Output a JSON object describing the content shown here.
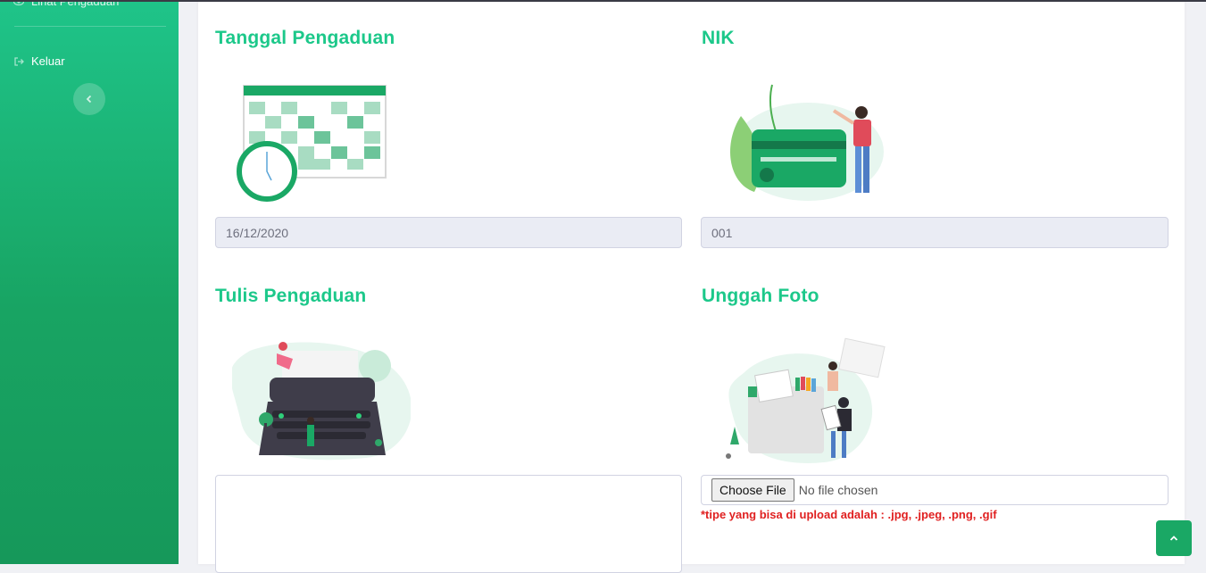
{
  "sidebar": {
    "items": [
      {
        "label": "Lihat Pengaduan",
        "icon": "eye-icon"
      },
      {
        "label": "Keluar",
        "icon": "sign-out-icon"
      }
    ],
    "toggle_icon": "chevron-left-icon"
  },
  "form": {
    "tanggal": {
      "title": "Tanggal Pengaduan",
      "value": "16/12/2020",
      "illustration": "calendar-clock-illustration"
    },
    "nik": {
      "title": "NIK",
      "value": "001",
      "illustration": "id-card-illustration"
    },
    "tulis": {
      "title": "Tulis Pengaduan",
      "value": "",
      "illustration": "typewriter-illustration"
    },
    "foto": {
      "title": "Unggah Foto",
      "button_label": "Choose File",
      "status": "No file chosen",
      "hint": "*tipe yang bisa di upload adalah : .jpg, .jpeg, .png, .gif",
      "illustration": "upload-folder-illustration"
    }
  },
  "scroll_top_icon": "chevron-up-icon",
  "colors": {
    "accent": "#1cc88a",
    "sidebar": "#18a463",
    "hint": "#e02020"
  }
}
